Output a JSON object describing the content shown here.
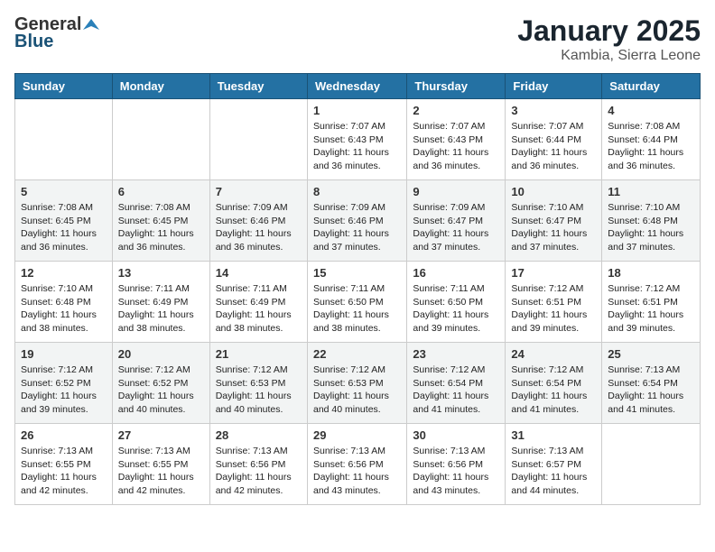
{
  "header": {
    "logo_general": "General",
    "logo_blue": "Blue",
    "title": "January 2025",
    "subtitle": "Kambia, Sierra Leone"
  },
  "days_of_week": [
    "Sunday",
    "Monday",
    "Tuesday",
    "Wednesday",
    "Thursday",
    "Friday",
    "Saturday"
  ],
  "weeks": [
    [
      {
        "day": "",
        "info": ""
      },
      {
        "day": "",
        "info": ""
      },
      {
        "day": "",
        "info": ""
      },
      {
        "day": "1",
        "info": "Sunrise: 7:07 AM\nSunset: 6:43 PM\nDaylight: 11 hours and 36 minutes."
      },
      {
        "day": "2",
        "info": "Sunrise: 7:07 AM\nSunset: 6:43 PM\nDaylight: 11 hours and 36 minutes."
      },
      {
        "day": "3",
        "info": "Sunrise: 7:07 AM\nSunset: 6:44 PM\nDaylight: 11 hours and 36 minutes."
      },
      {
        "day": "4",
        "info": "Sunrise: 7:08 AM\nSunset: 6:44 PM\nDaylight: 11 hours and 36 minutes."
      }
    ],
    [
      {
        "day": "5",
        "info": "Sunrise: 7:08 AM\nSunset: 6:45 PM\nDaylight: 11 hours and 36 minutes."
      },
      {
        "day": "6",
        "info": "Sunrise: 7:08 AM\nSunset: 6:45 PM\nDaylight: 11 hours and 36 minutes."
      },
      {
        "day": "7",
        "info": "Sunrise: 7:09 AM\nSunset: 6:46 PM\nDaylight: 11 hours and 36 minutes."
      },
      {
        "day": "8",
        "info": "Sunrise: 7:09 AM\nSunset: 6:46 PM\nDaylight: 11 hours and 37 minutes."
      },
      {
        "day": "9",
        "info": "Sunrise: 7:09 AM\nSunset: 6:47 PM\nDaylight: 11 hours and 37 minutes."
      },
      {
        "day": "10",
        "info": "Sunrise: 7:10 AM\nSunset: 6:47 PM\nDaylight: 11 hours and 37 minutes."
      },
      {
        "day": "11",
        "info": "Sunrise: 7:10 AM\nSunset: 6:48 PM\nDaylight: 11 hours and 37 minutes."
      }
    ],
    [
      {
        "day": "12",
        "info": "Sunrise: 7:10 AM\nSunset: 6:48 PM\nDaylight: 11 hours and 38 minutes."
      },
      {
        "day": "13",
        "info": "Sunrise: 7:11 AM\nSunset: 6:49 PM\nDaylight: 11 hours and 38 minutes."
      },
      {
        "day": "14",
        "info": "Sunrise: 7:11 AM\nSunset: 6:49 PM\nDaylight: 11 hours and 38 minutes."
      },
      {
        "day": "15",
        "info": "Sunrise: 7:11 AM\nSunset: 6:50 PM\nDaylight: 11 hours and 38 minutes."
      },
      {
        "day": "16",
        "info": "Sunrise: 7:11 AM\nSunset: 6:50 PM\nDaylight: 11 hours and 39 minutes."
      },
      {
        "day": "17",
        "info": "Sunrise: 7:12 AM\nSunset: 6:51 PM\nDaylight: 11 hours and 39 minutes."
      },
      {
        "day": "18",
        "info": "Sunrise: 7:12 AM\nSunset: 6:51 PM\nDaylight: 11 hours and 39 minutes."
      }
    ],
    [
      {
        "day": "19",
        "info": "Sunrise: 7:12 AM\nSunset: 6:52 PM\nDaylight: 11 hours and 39 minutes."
      },
      {
        "day": "20",
        "info": "Sunrise: 7:12 AM\nSunset: 6:52 PM\nDaylight: 11 hours and 40 minutes."
      },
      {
        "day": "21",
        "info": "Sunrise: 7:12 AM\nSunset: 6:53 PM\nDaylight: 11 hours and 40 minutes."
      },
      {
        "day": "22",
        "info": "Sunrise: 7:12 AM\nSunset: 6:53 PM\nDaylight: 11 hours and 40 minutes."
      },
      {
        "day": "23",
        "info": "Sunrise: 7:12 AM\nSunset: 6:54 PM\nDaylight: 11 hours and 41 minutes."
      },
      {
        "day": "24",
        "info": "Sunrise: 7:12 AM\nSunset: 6:54 PM\nDaylight: 11 hours and 41 minutes."
      },
      {
        "day": "25",
        "info": "Sunrise: 7:13 AM\nSunset: 6:54 PM\nDaylight: 11 hours and 41 minutes."
      }
    ],
    [
      {
        "day": "26",
        "info": "Sunrise: 7:13 AM\nSunset: 6:55 PM\nDaylight: 11 hours and 42 minutes."
      },
      {
        "day": "27",
        "info": "Sunrise: 7:13 AM\nSunset: 6:55 PM\nDaylight: 11 hours and 42 minutes."
      },
      {
        "day": "28",
        "info": "Sunrise: 7:13 AM\nSunset: 6:56 PM\nDaylight: 11 hours and 42 minutes."
      },
      {
        "day": "29",
        "info": "Sunrise: 7:13 AM\nSunset: 6:56 PM\nDaylight: 11 hours and 43 minutes."
      },
      {
        "day": "30",
        "info": "Sunrise: 7:13 AM\nSunset: 6:56 PM\nDaylight: 11 hours and 43 minutes."
      },
      {
        "day": "31",
        "info": "Sunrise: 7:13 AM\nSunset: 6:57 PM\nDaylight: 11 hours and 44 minutes."
      },
      {
        "day": "",
        "info": ""
      }
    ]
  ]
}
